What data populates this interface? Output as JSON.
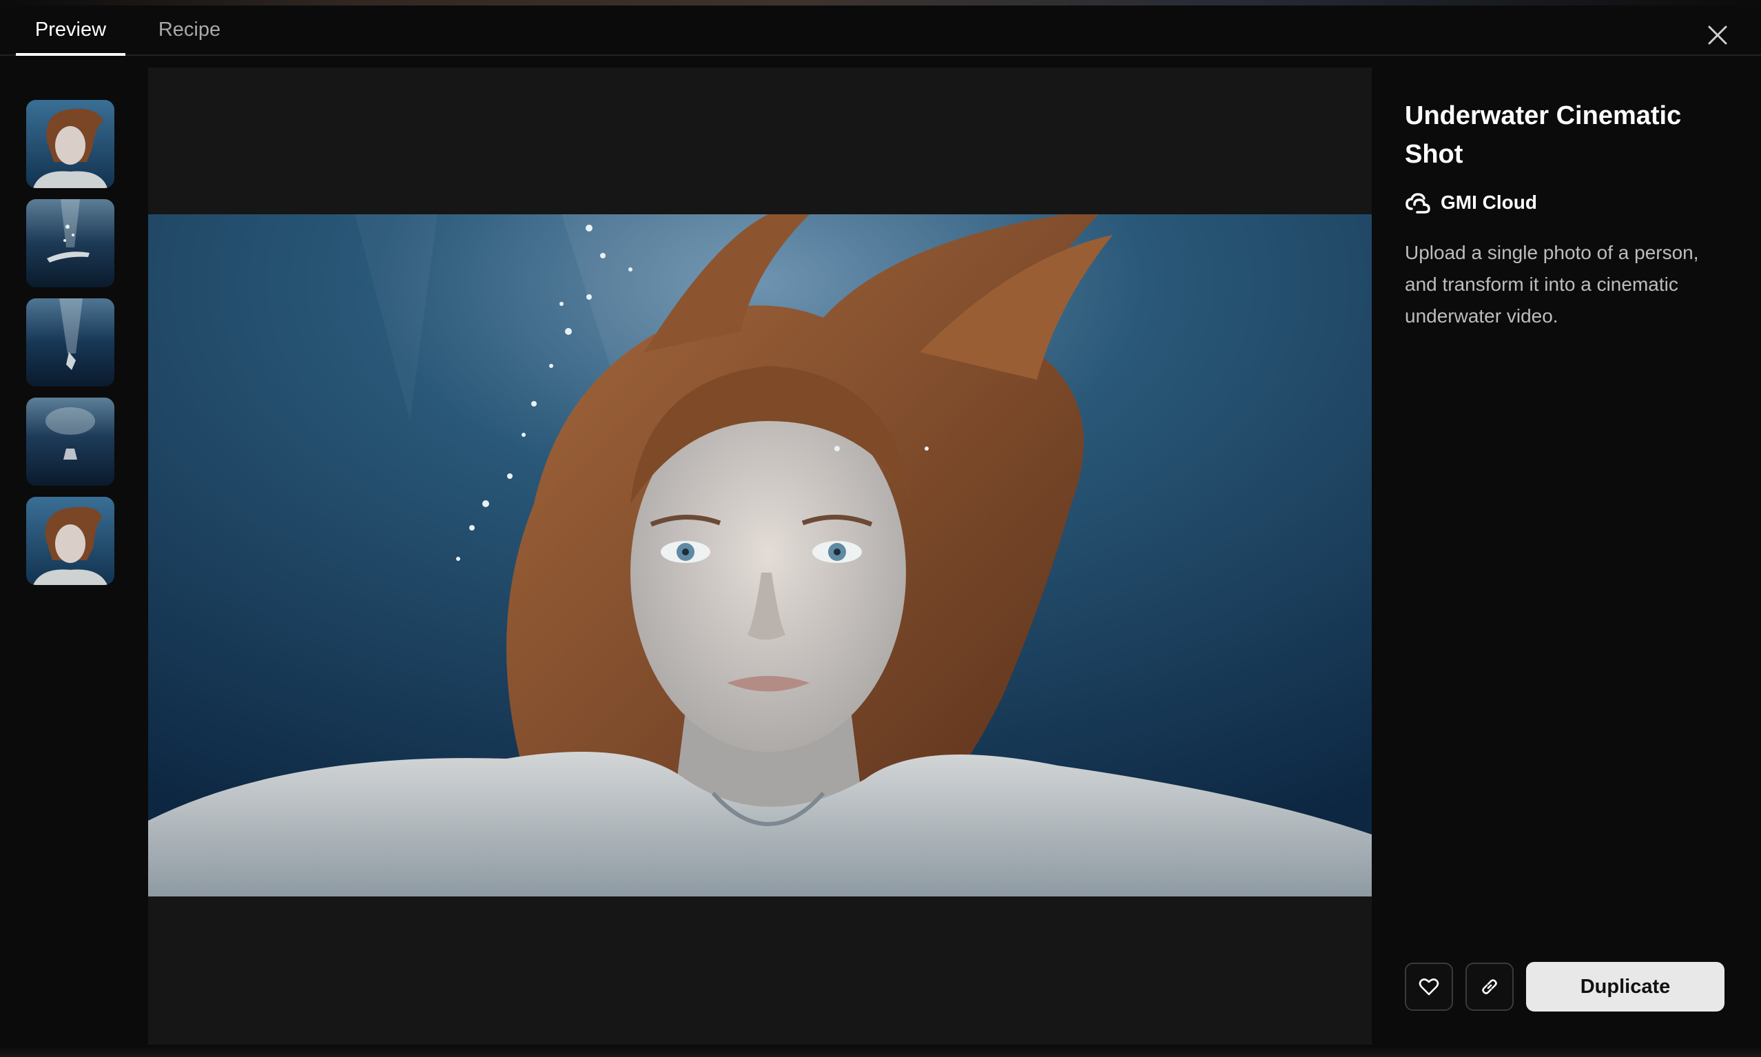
{
  "tabs": [
    {
      "label": "Preview",
      "active": true
    },
    {
      "label": "Recipe",
      "active": false
    }
  ],
  "close_icon": "close-icon",
  "thumbnails": [
    {
      "name": "thumbnail-portrait-closeup"
    },
    {
      "name": "thumbnail-diver-bubbles"
    },
    {
      "name": "thumbnail-diver-descending"
    },
    {
      "name": "thumbnail-diver-deep"
    },
    {
      "name": "thumbnail-portrait-closeup-2"
    }
  ],
  "preview": {
    "subject": "underwater portrait"
  },
  "panel": {
    "title": "Underwater Cinematic Shot",
    "author": "GMI Cloud",
    "description": "Upload a single photo of a person, and transform it into a cinematic underwater video."
  },
  "actions": {
    "like_icon": "heart-icon",
    "link_icon": "link-icon",
    "duplicate_label": "Duplicate"
  },
  "colors": {
    "background": "#0b0b0b",
    "preview_bg": "#161616",
    "button_bg": "#e8e8e8",
    "text_muted": "#bdbdbd"
  }
}
